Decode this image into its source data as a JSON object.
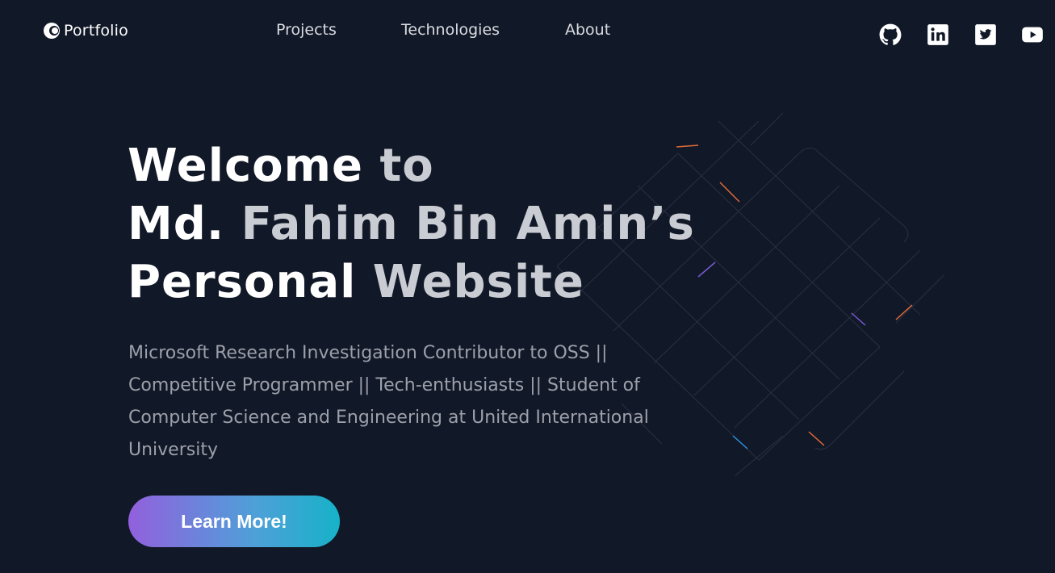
{
  "nav": {
    "logo_text": "Portfolio",
    "links": [
      {
        "label": "Projects"
      },
      {
        "label": "Technologies"
      },
      {
        "label": "About"
      }
    ],
    "social": [
      {
        "icon": "github-icon"
      },
      {
        "icon": "linkedin-icon"
      },
      {
        "icon": "twitter-icon"
      },
      {
        "icon": "youtube-icon"
      }
    ]
  },
  "hero": {
    "title_line1_a": "Welcome",
    "title_line1_b": " to",
    "title_line2_a": "Md.",
    "title_line2_b": " Fahim Bin Amin’s",
    "title_line3_a": "Personal",
    "title_line3_b": " Website",
    "description": "Microsoft Research Investigation Contributor to OSS || Competitive Programmer || Tech-enthusiasts || Student of Computer Science and Engineering at United International University",
    "cta_label": "Learn More!"
  },
  "colors": {
    "background": "#111827",
    "title_primary": "#ffffff",
    "title_secondary": "#c9ccd2",
    "description": "#9ca0aa",
    "cta_gradient_start": "#9260dd",
    "cta_gradient_end": "#16b2c8"
  }
}
